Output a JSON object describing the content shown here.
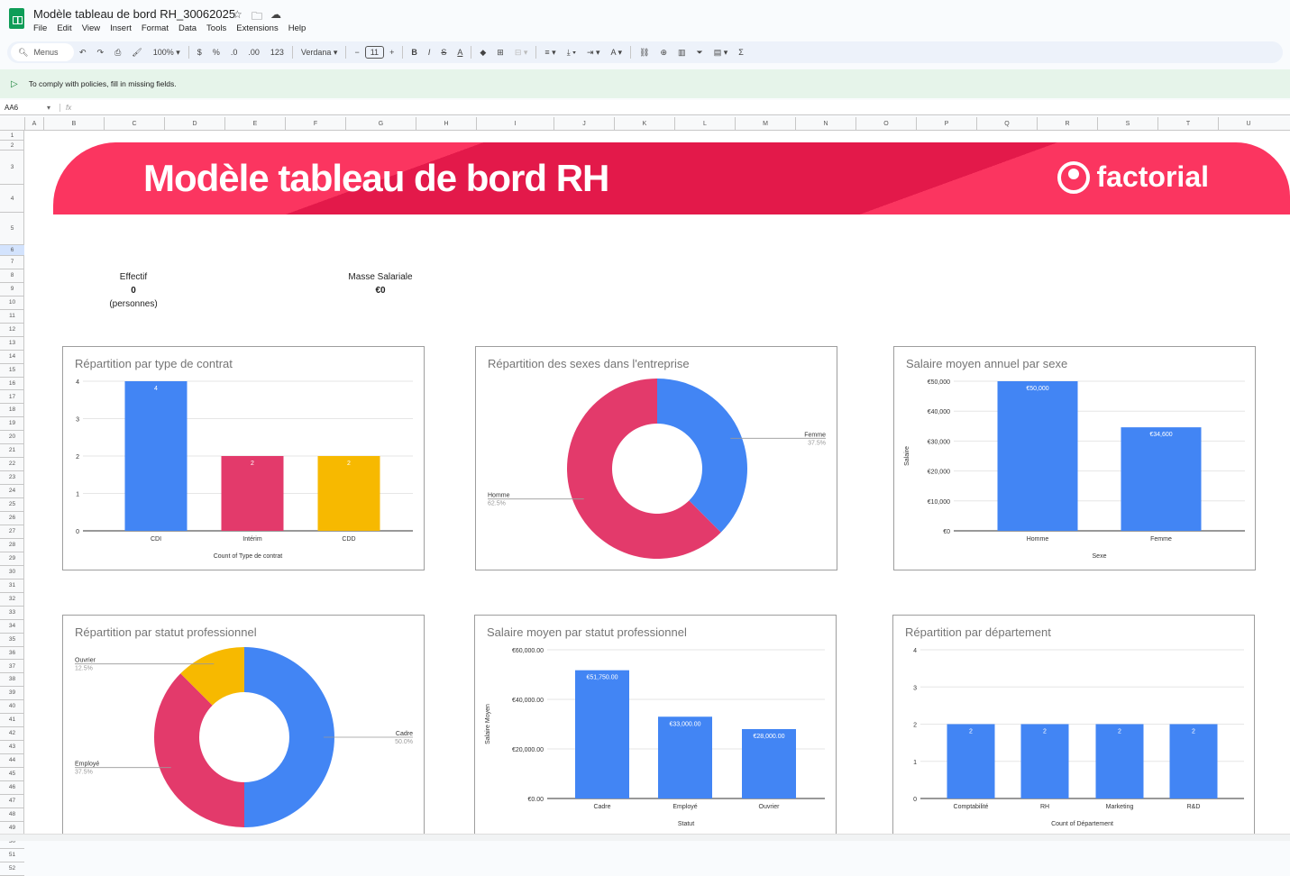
{
  "app": {
    "title": "Modèle tableau de bord RH_30062025",
    "menu": [
      "File",
      "Edit",
      "View",
      "Insert",
      "Format",
      "Data",
      "Tools",
      "Extensions",
      "Help"
    ]
  },
  "toolbar": {
    "search": "Menus",
    "zoom": "100%",
    "currency": "$",
    "percent": "%",
    "dec_less": ".0",
    "dec_more": ".00",
    "format_123": "123",
    "font": "Verdana",
    "font_size": "11"
  },
  "banner": {
    "text": "To comply with policies, fill in missing fields."
  },
  "formula_bar": {
    "cell_ref": "AA6",
    "fx": "fx"
  },
  "columns": [
    "A",
    "B",
    "C",
    "D",
    "E",
    "F",
    "G",
    "H",
    "I",
    "J",
    "K",
    "L",
    "M",
    "N",
    "O",
    "P",
    "Q",
    "R",
    "S",
    "T",
    "U"
  ],
  "hero": {
    "title": "Modèle tableau de bord RH",
    "brand": "factorial"
  },
  "kpis": {
    "effectif_label": "Effectif",
    "effectif_value": "0",
    "effectif_unit": "(personnes)",
    "masse_label": "Masse Salariale",
    "masse_value": "€0"
  },
  "colors": {
    "blue": "#4285f4",
    "pink": "#e33a6b",
    "yellow": "#f7b900",
    "brand": "#e3194a"
  },
  "chart_data": [
    {
      "type": "bar",
      "title": "Répartition par type de contrat",
      "categories": [
        "CDI",
        "Intérim",
        "CDD"
      ],
      "values": [
        4,
        2,
        2
      ],
      "data_labels": [
        "4",
        "2",
        "2"
      ],
      "colors": [
        "#4285f4",
        "#e33a6b",
        "#f7b900"
      ],
      "ylim": [
        0,
        4
      ],
      "yticks": [
        0,
        1,
        2,
        3,
        4
      ],
      "ytick_labels": [
        "0",
        "1",
        "2",
        "3",
        "4"
      ],
      "xlabel": "Count of Type de contrat",
      "ylabel": "",
      "grid": true
    },
    {
      "type": "pie",
      "donut": true,
      "title": "Répartition des sexes dans l'entreprise",
      "slices": [
        {
          "label": "Femme",
          "value": 37.5,
          "pct": "37.5%",
          "color": "#4285f4"
        },
        {
          "label": "Homme",
          "value": 62.5,
          "pct": "62.5%",
          "color": "#e33a6b"
        }
      ]
    },
    {
      "type": "bar",
      "title": "Salaire moyen annuel par sexe",
      "categories": [
        "Homme",
        "Femme"
      ],
      "values": [
        50000,
        34600
      ],
      "data_labels": [
        "€50,000",
        "€34,600"
      ],
      "colors": [
        "#4285f4",
        "#4285f4"
      ],
      "ylim": [
        0,
        50000
      ],
      "yticks": [
        0,
        10000,
        20000,
        30000,
        40000,
        50000
      ],
      "ytick_labels": [
        "€0",
        "€10,000",
        "€20,000",
        "€30,000",
        "€40,000",
        "€50,000"
      ],
      "xlabel": "Sexe",
      "ylabel": "Salaire",
      "grid": true
    },
    {
      "type": "pie",
      "donut": true,
      "title": "Répartition par statut professionnel",
      "slices": [
        {
          "label": "Cadre",
          "value": 50,
          "pct": "50.0%",
          "color": "#4285f4"
        },
        {
          "label": "Employé",
          "value": 37.5,
          "pct": "37.5%",
          "color": "#e33a6b"
        },
        {
          "label": "Ouvrier",
          "value": 12.5,
          "pct": "12.5%",
          "color": "#f7b900"
        }
      ]
    },
    {
      "type": "bar",
      "title": "Salaire moyen par statut professionnel",
      "categories": [
        "Cadre",
        "Employé",
        "Ouvrier"
      ],
      "values": [
        51750,
        33000,
        28000
      ],
      "data_labels": [
        "€51,750.00",
        "€33,000.00",
        "€28,000.00"
      ],
      "colors": [
        "#4285f4",
        "#4285f4",
        "#4285f4"
      ],
      "ylim": [
        0,
        60000
      ],
      "yticks": [
        0,
        20000,
        40000,
        60000
      ],
      "ytick_labels": [
        "€0.00",
        "€20,000.00",
        "€40,000.00",
        "€60,000.00"
      ],
      "xlabel": "Statut",
      "ylabel": "Salaire Moyen",
      "grid": true
    },
    {
      "type": "bar",
      "title": "Répartition par département",
      "categories": [
        "Comptabilité",
        "RH",
        "Marketing",
        "R&D"
      ],
      "values": [
        2,
        2,
        2,
        2
      ],
      "data_labels": [
        "2",
        "2",
        "2",
        "2"
      ],
      "colors": [
        "#4285f4",
        "#4285f4",
        "#4285f4",
        "#4285f4"
      ],
      "ylim": [
        0,
        4
      ],
      "yticks": [
        0,
        1,
        2,
        3,
        4
      ],
      "ytick_labels": [
        "0",
        "1",
        "2",
        "3",
        "4"
      ],
      "xlabel": "Count of Département",
      "ylabel": "",
      "grid": true
    }
  ]
}
